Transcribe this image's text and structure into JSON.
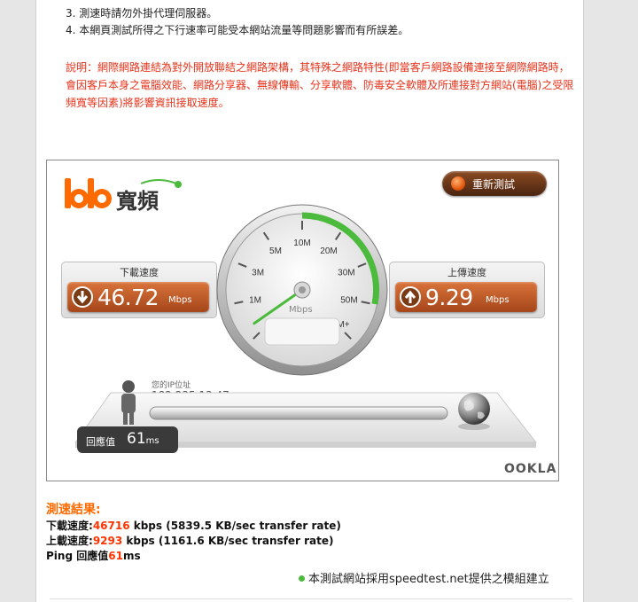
{
  "notes": [
    "3. 測速時請勿外掛代理伺服器。",
    "4. 本網頁測試所得之下行速率可能受本網站流量等問題影響而有所誤差。"
  ],
  "disclaimer": "說明：網際網路連結為對外開放聯結之網路架構，其特殊之網路特性(即當客戶網路設備連接至網際網路時， 會因客戶本身之電腦效能、網路分享器、無線傳輸、分享軟體、防毒安全軟體及所連接對方網站(電腦)之受限頻寬等因素)將影響資訊接取速度。",
  "widget": {
    "logo_text": "寬頻",
    "retest_label": "重新測試",
    "download": {
      "label": "下載速度",
      "value": "46.72",
      "unit": "Mbps"
    },
    "upload": {
      "label": "上傳速度",
      "value": "9.29",
      "unit": "Mbps"
    },
    "gauge": {
      "ticks": [
        "0",
        "1M",
        "3M",
        "5M",
        "10M",
        "20M",
        "30M",
        "50M",
        "100M+"
      ],
      "unit_label": "Mbps",
      "needle_value_mbps": 0.3
    },
    "ip_label": "您的IP位址",
    "ip_value": "182.235.13.47",
    "ping_label": "回應值",
    "ping_value": "61",
    "ping_unit": "ms",
    "brand": "OOKLA"
  },
  "results": {
    "title": "測速結果:",
    "download_prefix": "下載速度:",
    "download_kbps": "46716",
    "download_suffix": " kbps (5839.5 KB/sec transfer rate)",
    "upload_prefix": "上載速度:",
    "upload_kbps": "9293",
    "upload_suffix": " kbps (1161.6 KB/sec transfer rate)",
    "ping_prefix": "Ping 回應值",
    "ping_value": "61",
    "ping_suffix": "ms"
  },
  "credit": "本測試網站採用speedtest.net提供之模組建立",
  "colors": {
    "accent_orange": "#ff6a00",
    "highlight_red": "#ff3300",
    "disclaimer_red": "#e8321a",
    "speed_box": "#c05a26",
    "gauge_green": "#4cba3c"
  }
}
